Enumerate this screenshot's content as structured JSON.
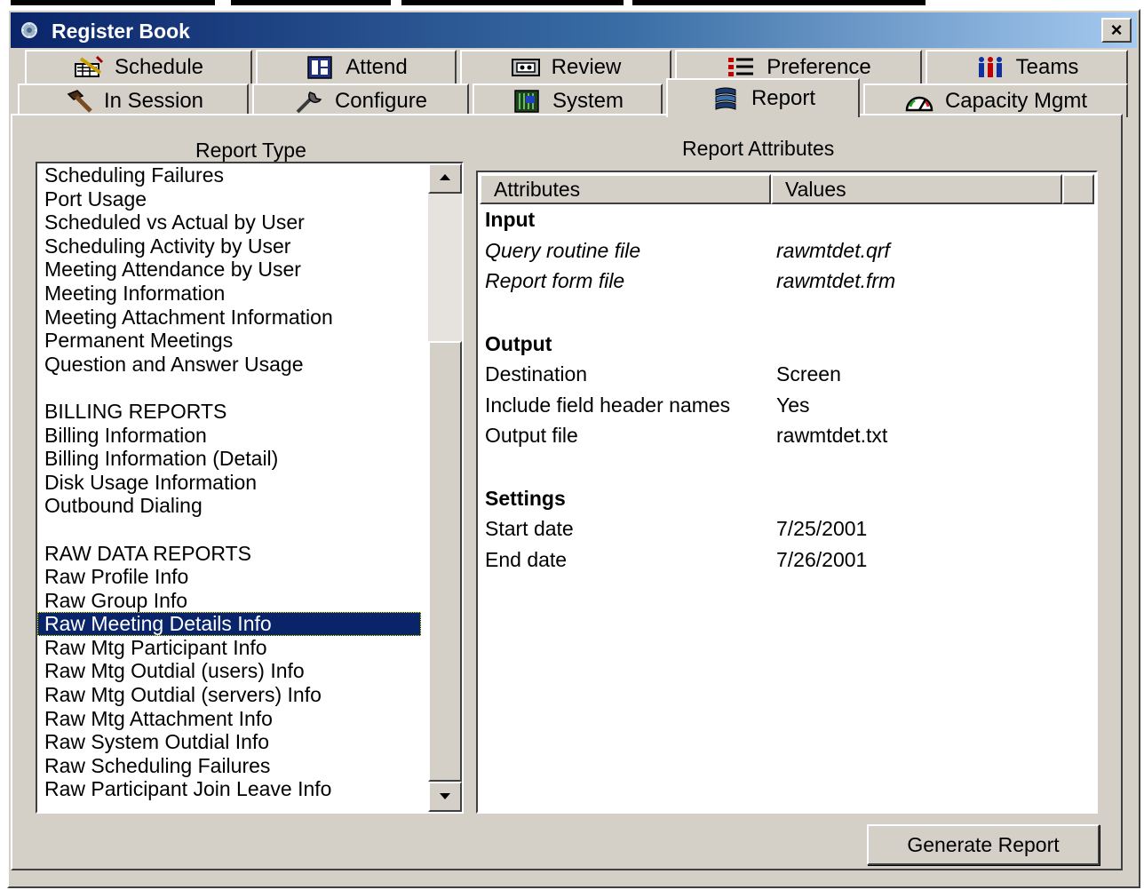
{
  "window": {
    "title": "Register Book",
    "close_label": "×"
  },
  "tabs": {
    "row1": [
      {
        "label": "Schedule",
        "icon": "schedule-icon"
      },
      {
        "label": "Attend",
        "icon": "attend-icon"
      },
      {
        "label": "Review",
        "icon": "review-icon"
      },
      {
        "label": "Preference",
        "icon": "preference-icon"
      },
      {
        "label": "Teams",
        "icon": "teams-icon"
      }
    ],
    "row2": [
      {
        "label": "In Session",
        "icon": "hammer-icon"
      },
      {
        "label": "Configure",
        "icon": "wrench-icon"
      },
      {
        "label": "System",
        "icon": "system-icon"
      },
      {
        "label": "Report",
        "icon": "report-icon",
        "active": true
      },
      {
        "label": "Capacity Mgmt",
        "icon": "gauge-icon"
      }
    ]
  },
  "report_type": {
    "label": "Report Type",
    "items": [
      {
        "text": "Scheduling Failures"
      },
      {
        "text": "Port Usage"
      },
      {
        "text": "Scheduled vs Actual by User"
      },
      {
        "text": "Scheduling Activity by User"
      },
      {
        "text": "Meeting Attendance by User"
      },
      {
        "text": "Meeting Information"
      },
      {
        "text": "Meeting Attachment Information"
      },
      {
        "text": "Permanent Meetings"
      },
      {
        "text": "Question and Answer Usage"
      },
      {
        "text": ""
      },
      {
        "text": "BILLING REPORTS",
        "heading": true
      },
      {
        "text": "Billing Information"
      },
      {
        "text": "Billing Information (Detail)"
      },
      {
        "text": "Disk Usage Information"
      },
      {
        "text": "Outbound Dialing"
      },
      {
        "text": ""
      },
      {
        "text": "RAW DATA REPORTS",
        "heading": true
      },
      {
        "text": "Raw Profile Info"
      },
      {
        "text": "Raw Group Info"
      },
      {
        "text": "Raw Meeting Details Info",
        "selected": true
      },
      {
        "text": "Raw Mtg Participant Info"
      },
      {
        "text": "Raw Mtg Outdial (users) Info"
      },
      {
        "text": "Raw Mtg Outdial (servers) Info"
      },
      {
        "text": "Raw Mtg Attachment Info"
      },
      {
        "text": "Raw System Outdial Info"
      },
      {
        "text": "Raw Scheduling Failures"
      },
      {
        "text": "Raw Participant Join Leave Info"
      }
    ]
  },
  "report_attributes": {
    "label": "Report Attributes",
    "columns": [
      "Attributes",
      "Values"
    ],
    "rows": [
      {
        "attr": "Input",
        "value": "",
        "kind": "section"
      },
      {
        "attr": "Query routine file",
        "value": "rawmtdet.qrf",
        "kind": "italic"
      },
      {
        "attr": "Report form file",
        "value": "rawmtdet.frm",
        "kind": "italic"
      },
      {
        "attr": "Output",
        "value": "",
        "kind": "section"
      },
      {
        "attr": "Destination",
        "value": "Screen",
        "kind": "normal"
      },
      {
        "attr": "Include field header names",
        "value": "Yes",
        "kind": "normal"
      },
      {
        "attr": "Output file",
        "value": "rawmtdet.txt",
        "kind": "normal"
      },
      {
        "attr": "Settings",
        "value": "",
        "kind": "section"
      },
      {
        "attr": "Start date",
        "value": "7/25/2001",
        "kind": "normal"
      },
      {
        "attr": "End date",
        "value": "7/26/2001",
        "kind": "normal"
      }
    ]
  },
  "actions": {
    "generate_label": "Generate Report"
  },
  "colors": {
    "face": "#d4d0c8",
    "title_start": "#0a246a",
    "title_end": "#a6caf0",
    "selection": "#0a246a"
  }
}
